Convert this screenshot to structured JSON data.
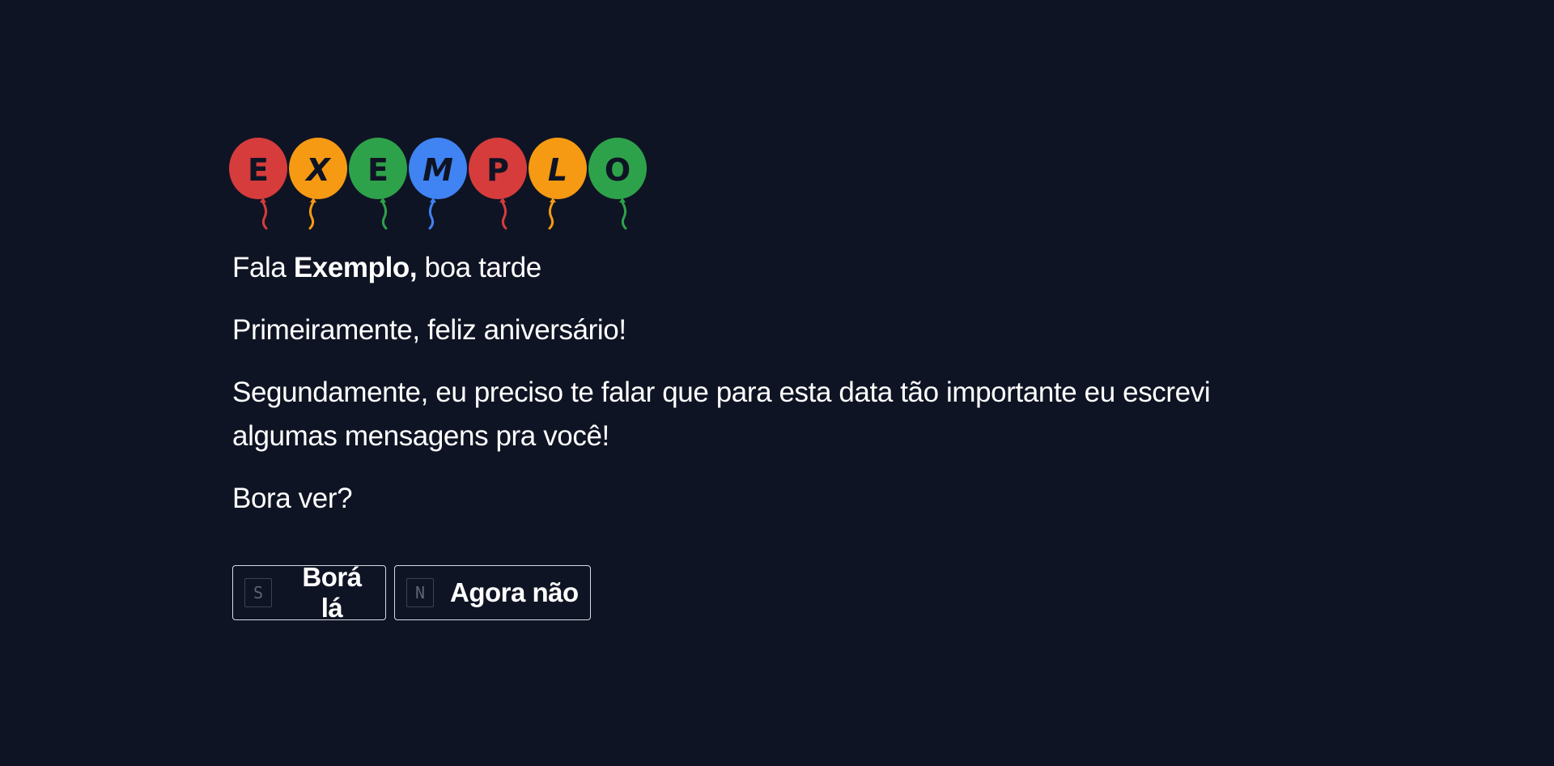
{
  "balloons": [
    {
      "letter": "E",
      "color": "#d63c3c"
    },
    {
      "letter": "X",
      "color": "#f59a12"
    },
    {
      "letter": "E",
      "color": "#2ea24a"
    },
    {
      "letter": "M",
      "color": "#4083f2"
    },
    {
      "letter": "P",
      "color": "#d63c3c"
    },
    {
      "letter": "L",
      "color": "#f59a12"
    },
    {
      "letter": "O",
      "color": "#2ea24a"
    }
  ],
  "message": {
    "greeting_prefix": "Fala ",
    "name": "Exemplo,",
    "greeting_suffix": " boa tarde",
    "line2": "Primeiramente, feliz aniversário!",
    "line3": "Segundamente, eu preciso te falar que para esta data tão importante eu escrevi algumas mensagens pra você!",
    "line4": "Bora ver?"
  },
  "buttons": {
    "yes": {
      "key": "S",
      "label": "Borá lá"
    },
    "no": {
      "key": "N",
      "label": "Agora não"
    }
  },
  "colors": {
    "background": "#0f1424",
    "text": "#ffffff",
    "button_border": "#d8dbe2",
    "key_border": "#3b4256"
  }
}
